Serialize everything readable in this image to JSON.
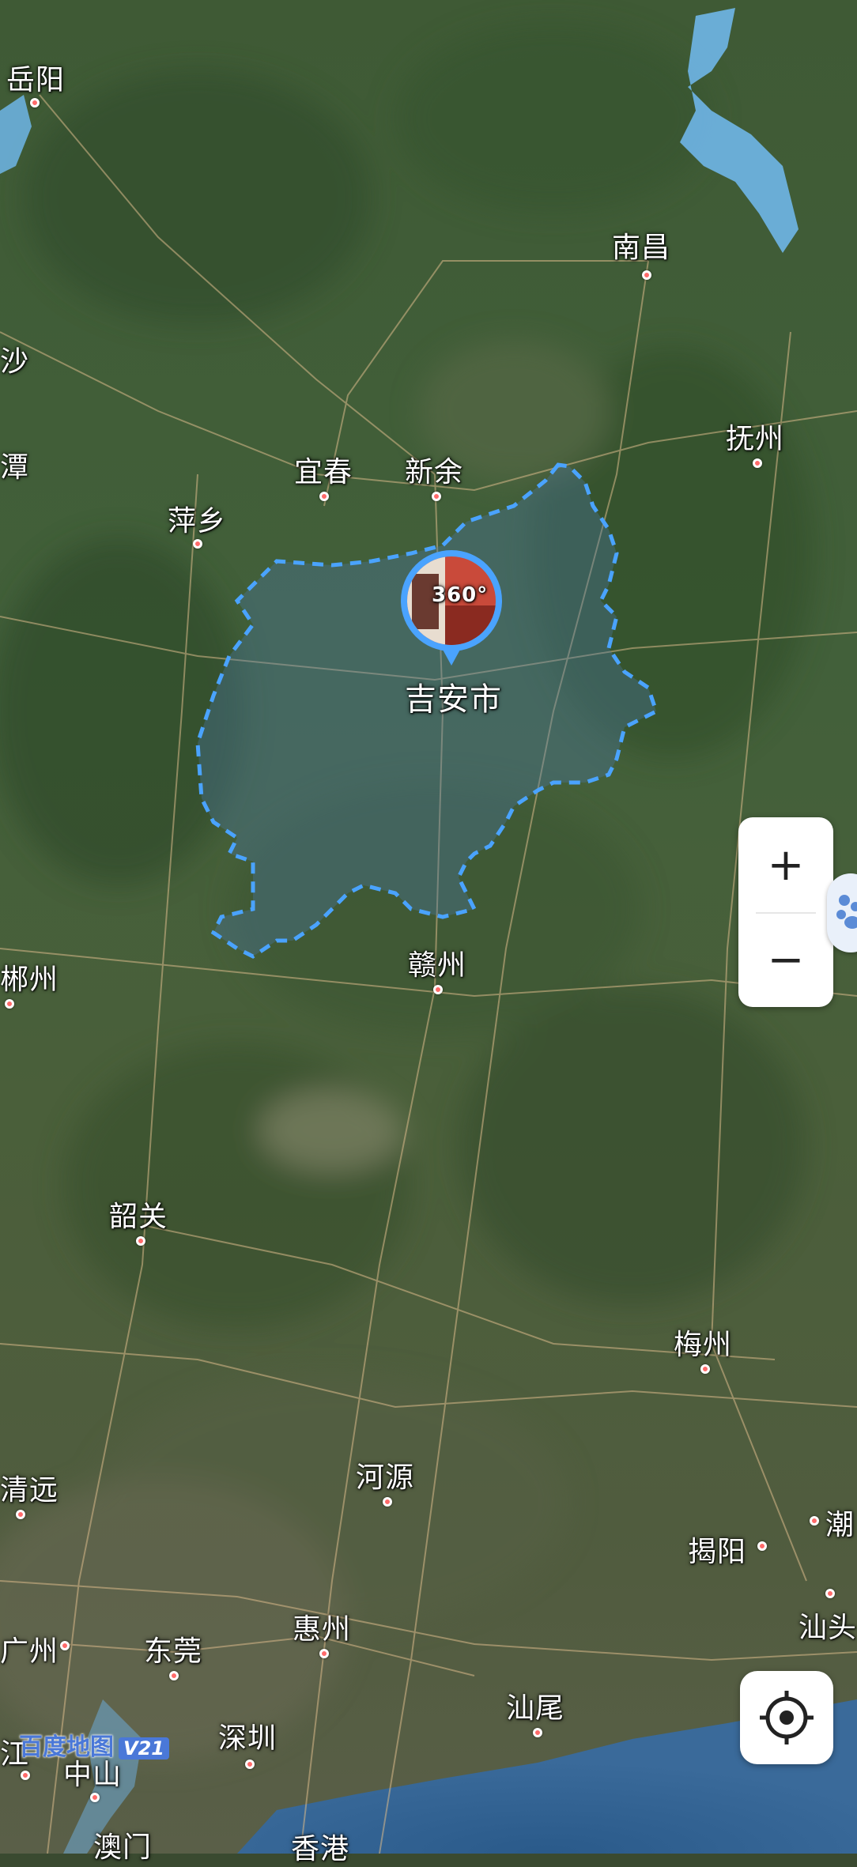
{
  "map": {
    "region_label": "吉安市",
    "cities": [
      {
        "name": "岳阳"
      },
      {
        "name": "南昌"
      },
      {
        "name": "沙"
      },
      {
        "name": "抚州"
      },
      {
        "name": "潭"
      },
      {
        "name": "宜春"
      },
      {
        "name": "新余"
      },
      {
        "name": "萍乡"
      },
      {
        "name": "赣州"
      },
      {
        "name": "郴州"
      },
      {
        "name": "韶关"
      },
      {
        "name": "梅州"
      },
      {
        "name": "河源"
      },
      {
        "name": "清远"
      },
      {
        "name": "揭阳"
      },
      {
        "name": "潮"
      },
      {
        "name": "汕头"
      },
      {
        "name": "广州"
      },
      {
        "name": "东莞"
      },
      {
        "name": "惠州"
      },
      {
        "name": "深圳"
      },
      {
        "name": "汕尾"
      },
      {
        "name": "中山"
      },
      {
        "name": "澳门"
      },
      {
        "name": "香港"
      },
      {
        "name": "江"
      }
    ],
    "panorama_badge": "360°"
  },
  "controls": {
    "zoom_in": "+",
    "zoom_out": "−"
  },
  "branding": {
    "logo": "百度地图",
    "version": "V21"
  },
  "colors": {
    "boundary": "#4aa3ff",
    "city_dot": "#ff6b6b",
    "water": "#6fb6e8"
  }
}
